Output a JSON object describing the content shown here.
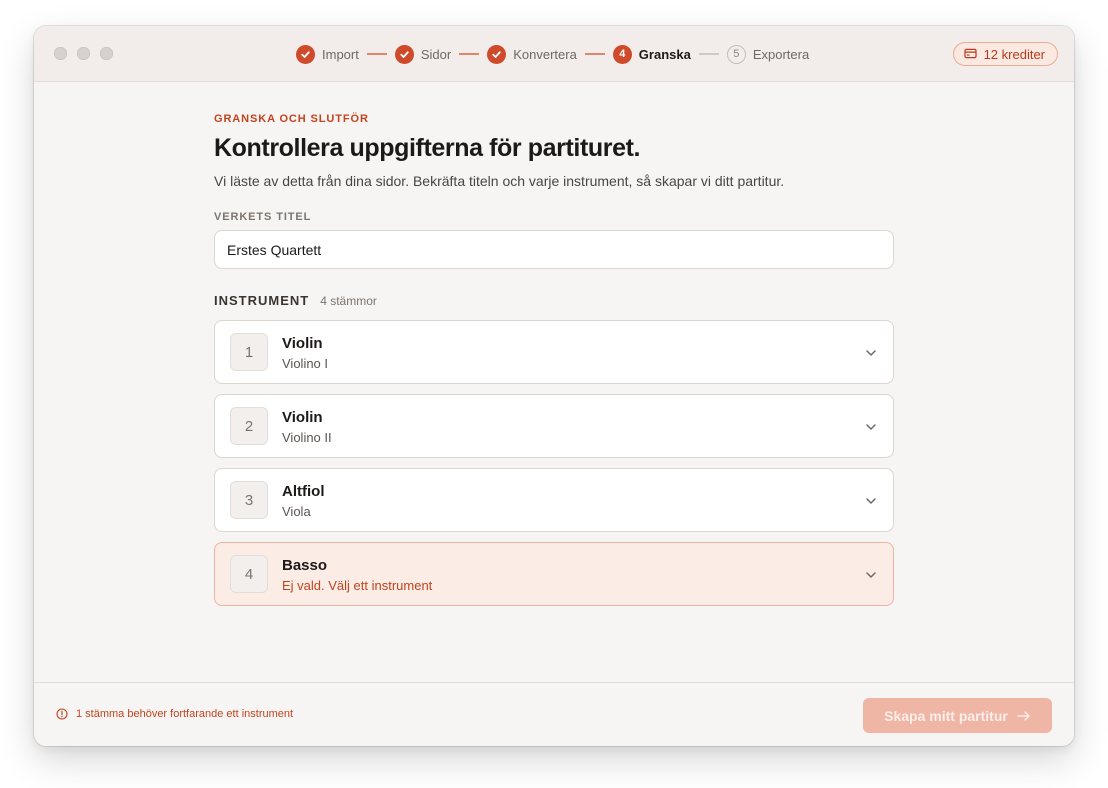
{
  "stepper": {
    "steps": [
      {
        "label": "Import",
        "state": "done",
        "marker": ""
      },
      {
        "label": "Sidor",
        "state": "done",
        "marker": ""
      },
      {
        "label": "Konvertera",
        "state": "done",
        "marker": ""
      },
      {
        "label": "Granska",
        "state": "active",
        "marker": "4"
      },
      {
        "label": "Exportera",
        "state": "todo",
        "marker": "5"
      }
    ]
  },
  "credits": {
    "label": "12 krediter",
    "icon": "credit-card-icon"
  },
  "page": {
    "eyebrow": "GRANSKA OCH SLUTFÖR",
    "title": "Kontrollera uppgifterna för partituret.",
    "subtitle": "Vi läste av detta från dina sidor. Bekräfta titeln och varje instrument, så skapar vi ditt partitur."
  },
  "work_title": {
    "label": "VERKETS TITEL",
    "value": "Erstes Quartett"
  },
  "instruments": {
    "heading": "INSTRUMENT",
    "count": "4 stämmor",
    "items": [
      {
        "num": "1",
        "name": "Violin",
        "sub": "Violino I",
        "warning": false
      },
      {
        "num": "2",
        "name": "Violin",
        "sub": "Violino II",
        "warning": false
      },
      {
        "num": "3",
        "name": "Altfiol",
        "sub": "Viola",
        "warning": false
      },
      {
        "num": "4",
        "name": "Basso",
        "sub": "Ej vald. Välj ett instrument",
        "warning": true
      }
    ]
  },
  "footer": {
    "message": "1 stämma behöver fortfarande ett instrument",
    "button": "Skapa mitt partitur"
  },
  "colors": {
    "accent": "#cf4a2a",
    "warning_text": "#c2431f",
    "warning_bg": "#fbece6",
    "button_disabled": "#efb5a5"
  }
}
